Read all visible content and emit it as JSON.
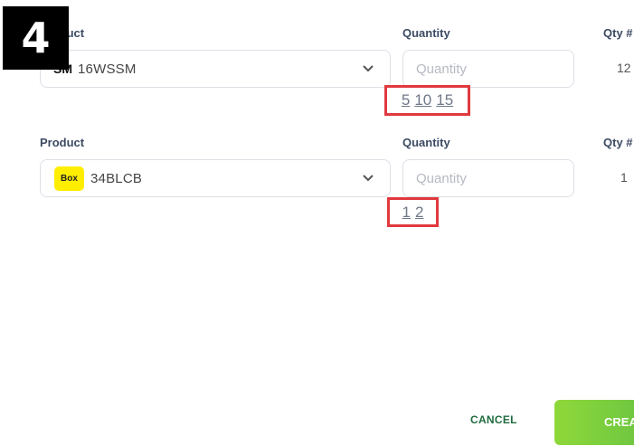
{
  "step_number": "4",
  "rows": [
    {
      "product_label": "Product",
      "product_code": "SM",
      "product_value": "16WSSM",
      "quantity_label": "Quantity",
      "quantity_placeholder": "Quantity",
      "qty_hash_label": "Qty #",
      "qty_hash_value": "12",
      "suggestions": [
        "5",
        "10",
        "15"
      ]
    },
    {
      "product_label": "Product",
      "product_code": "Box",
      "product_value": "34BLCB",
      "quantity_label": "Quantity",
      "quantity_placeholder": "Quantity",
      "qty_hash_label": "Qty #",
      "qty_hash_value": "1",
      "suggestions": [
        "1",
        "2"
      ]
    }
  ],
  "actions": {
    "cancel_label": "CANCEL",
    "create_label": "CREATE"
  },
  "colors": {
    "highlight_border": "#e0393e",
    "box_badge": "#ffee00",
    "create_button": "#7ccf3d",
    "cancel_text": "#1f6b3f"
  }
}
